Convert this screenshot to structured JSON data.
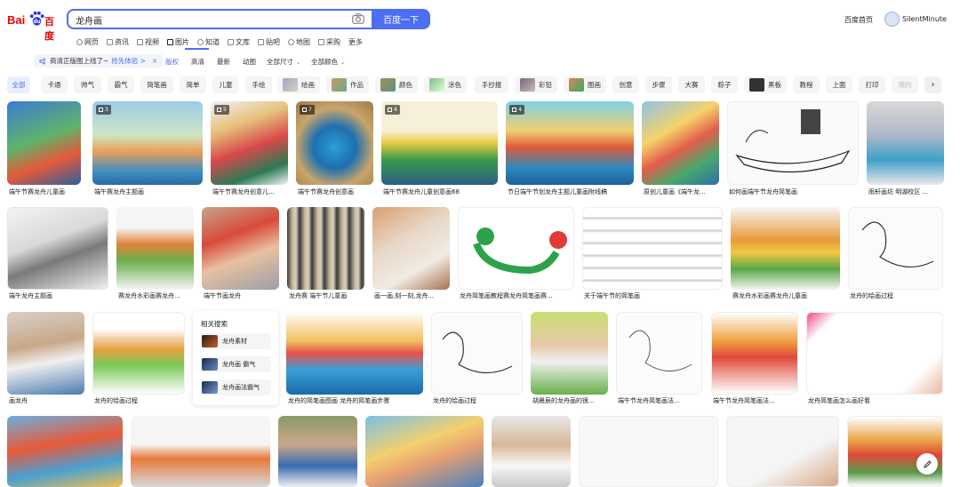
{
  "logo": {
    "text_left": "Bai",
    "text_right": "百度"
  },
  "search": {
    "query": "龙舟画",
    "button_label": "百度一下"
  },
  "header": {
    "home_link": "百度首页",
    "username": "SilentMinute"
  },
  "nav": {
    "items": [
      "网页",
      "资讯",
      "视频",
      "图片",
      "知道",
      "文库",
      "贴吧",
      "地图",
      "采购",
      "更多"
    ],
    "active": "图片"
  },
  "filters": {
    "notice_text": "商清正版图上线了~",
    "notice_link": "抢先体验 >",
    "items": [
      "版权",
      "高清",
      "最新",
      "动图",
      "全部尺寸",
      "全部颜色"
    ]
  },
  "chips": [
    "全部",
    "卡通",
    "帅气",
    "霸气",
    "简笔画",
    "简单",
    "儿童",
    "手绘",
    "绘画",
    "作品",
    "颜色",
    "涂色",
    "手抄报",
    "彩铅",
    "图画",
    "创意",
    "步骤",
    "大赛",
    "粽子",
    "黑板",
    "教程",
    "上面",
    "打印",
    "简约"
  ],
  "results": {
    "row1": [
      {
        "caption": "端午节赛龙舟儿童画",
        "badge": ""
      },
      {
        "caption": "端午赛龙舟主题画",
        "badge": "3"
      },
      {
        "caption": "端午节赛龙舟创意儿...",
        "badge": "5"
      },
      {
        "caption": "端午节赛龙舟创意画",
        "badge": "7"
      },
      {
        "caption": "端午节赛龙舟儿童创意画68",
        "badge": "4"
      },
      {
        "caption": "节日端午节划龙舟主题儿童画附线稿",
        "badge": "4"
      },
      {
        "caption": "原创儿童画《端午龙...",
        "badge": ""
      },
      {
        "caption": "如何画端午节龙舟简笔画",
        "badge": ""
      },
      {
        "caption": "雨轩画坊 明湖校区 ...",
        "badge": ""
      }
    ],
    "row2": [
      {
        "caption": "端午龙舟主题画"
      },
      {
        "caption": "赛龙舟水彩画赛龙舟..."
      },
      {
        "caption": "端午节画龙舟"
      },
      {
        "caption": "龙舟赛 端午节儿童画"
      },
      {
        "caption": "画一画,刻一刻,龙舟..."
      },
      {
        "caption": "龙舟简笔画教程赛龙舟简笔画赛..."
      },
      {
        "caption": "关于端午节的简笔画"
      },
      {
        "caption": "赛龙舟水彩画赛龙舟儿童画"
      },
      {
        "caption": "龙舟的绘画过程"
      }
    ],
    "row3": [
      {
        "caption": "画龙舟"
      },
      {
        "caption": "龙舟的绘画过程"
      },
      {
        "caption": "龙舟的简笔画图画 龙舟的简笔画步骤"
      },
      {
        "caption": "龙舟的绘画过程"
      },
      {
        "caption": "胡晨辰的龙舟画的很..."
      },
      {
        "caption": "端午节龙舟简笔画法..."
      },
      {
        "caption": "端午节龙舟简笔画法..."
      },
      {
        "caption": "龙舟简笔画怎么画好看"
      }
    ]
  },
  "related": {
    "title": "相关搜索",
    "items": [
      "龙舟素材",
      "龙舟画 霸气",
      "龙舟画法霸气"
    ]
  },
  "colors": {
    "accent": "#4e6ef2",
    "logo_red": "#e10602",
    "logo_blue": "#2932e1"
  }
}
